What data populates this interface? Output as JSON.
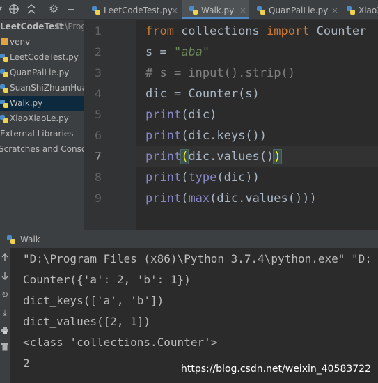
{
  "colors": {
    "keyword": "#CC7832",
    "string": "#6A8759",
    "comment": "#808080",
    "builtin": "#8888C6",
    "text": "#A9B7C6",
    "selection": "#0D293E",
    "tab_underline": "#4A88C7"
  },
  "toolbar": {
    "icons": [
      "dropdown-icon",
      "crosshair-icon",
      "collapse-all-icon",
      "gear-icon",
      "minimize-icon"
    ]
  },
  "project": {
    "root_name": "LeetCodeTest",
    "root_path": "D:\\Prog",
    "items": [
      {
        "label": "venv",
        "icon": "folder-icon"
      },
      {
        "label": "LeetCodeTest.py",
        "icon": "python-file-icon"
      },
      {
        "label": "QuanPaiLie.py",
        "icon": "python-file-icon"
      },
      {
        "label": "SuanShiZhuanHua",
        "icon": "python-file-icon"
      },
      {
        "label": "Walk.py",
        "icon": "python-file-icon"
      },
      {
        "label": "XiaoXiaoLe.py",
        "icon": "python-file-icon"
      }
    ],
    "external_libraries": "External Libraries",
    "scratches": "Scratches and Consoles"
  },
  "tabs": [
    {
      "label": "LeetCodeTest.py",
      "active": false
    },
    {
      "label": "Walk.py",
      "active": true
    },
    {
      "label": "QuanPaiLie.py",
      "active": false
    },
    {
      "label": "XiaoX",
      "active": false
    }
  ],
  "tab_close": "×",
  "editor": {
    "line_numbers": [
      "1",
      "2",
      "3",
      "4",
      "5",
      "6",
      "7",
      "8",
      "9"
    ],
    "current_line": "7",
    "lines": {
      "l1": {
        "k1": "from",
        "t1": " collections ",
        "k2": "import",
        "t2": " Counter"
      },
      "l2": {
        "t1": "s = ",
        "s1": "\"aba\""
      },
      "l3": {
        "c1": "# s = input().strip()"
      },
      "l4": {
        "t1": "dic = Counter(s)"
      },
      "l5": {
        "b1": "print",
        "t1": "(dic)"
      },
      "l6": {
        "b1": "print",
        "t1": "(dic.keys())"
      },
      "l7": {
        "b1": "print",
        "p1": "(",
        "t1": "dic.values()",
        "p2": ")"
      },
      "l8": {
        "b1": "print",
        "t1": "(",
        "b2": "type",
        "t2": "(dic))"
      },
      "l9": {
        "b1": "print",
        "t1": "(",
        "b2": "max",
        "t2": "(dic.values()))"
      }
    }
  },
  "run": {
    "title": "Walk",
    "side_icons": [
      "up-arrow-icon",
      "down-arrow-icon",
      "rerun-icon",
      "scroll-to-end-icon",
      "print-icon",
      "trash-icon"
    ],
    "output": [
      "\"D:\\Program Files (x86)\\Python 3.7.4\\python.exe\" \"D:",
      "Counter({'a': 2, 'b': 1})",
      "dict_keys(['a', 'b'])",
      "dict_values([2, 1])",
      "<class 'collections.Counter'>",
      "2"
    ]
  },
  "watermark": "https://blog.csdn.net/weixin_40583722"
}
